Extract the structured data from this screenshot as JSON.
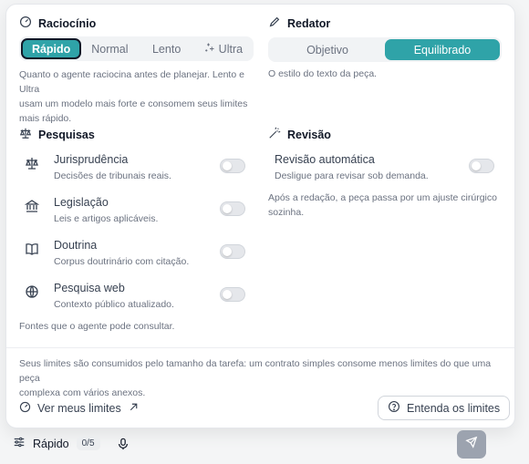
{
  "reasoning": {
    "title": "Raciocínio",
    "options": [
      "Rápido",
      "Normal",
      "Lento",
      "Ultra"
    ],
    "selected": "Rápido",
    "description_line1": "Quanto o agente raciocina antes de planejar. Lento e Ultra",
    "description_line2": "usam um modelo mais forte e consomem seus limites",
    "description_line3": "mais rápido."
  },
  "writer": {
    "title": "Redator",
    "options": [
      "Objetivo",
      "Equilibrado"
    ],
    "selected": "Equilibrado",
    "description": "O estilo do texto da peça."
  },
  "research": {
    "title": "Pesquisas",
    "items": [
      {
        "icon": "scale-icon",
        "title": "Jurisprudência",
        "subtitle": "Decisões de tribunais reais."
      },
      {
        "icon": "bank-icon",
        "title": "Legislação",
        "subtitle": "Leis e artigos aplicáveis."
      },
      {
        "icon": "book-icon",
        "title": "Doutrina",
        "subtitle": "Corpus doutrinário com citação."
      },
      {
        "icon": "globe-icon",
        "title": "Pesquisa web",
        "subtitle": "Contexto público atualizado."
      }
    ],
    "footer": "Fontes que o agente pode consultar."
  },
  "review": {
    "title": "Revisão",
    "item_title": "Revisão automática",
    "item_subtitle": "Desligue para revisar sob demanda.",
    "description_line1": "Após a redação, a peça passa por um ajuste cirúrgico",
    "description_line2": "sozinha."
  },
  "limits": {
    "note_line1": "Seus limites são consumidos pelo tamanho da tarefa: um contrato simples consome menos limites do que uma peça",
    "note_line2": "complexa com vários anexos.",
    "view_link": "Ver meus limites",
    "help_button": "Entenda os limites"
  },
  "composer": {
    "mode_label": "Rápido",
    "counter": "0/5"
  },
  "colors": {
    "accent": "#2fa3a8",
    "send_button": "#9ca3af"
  }
}
